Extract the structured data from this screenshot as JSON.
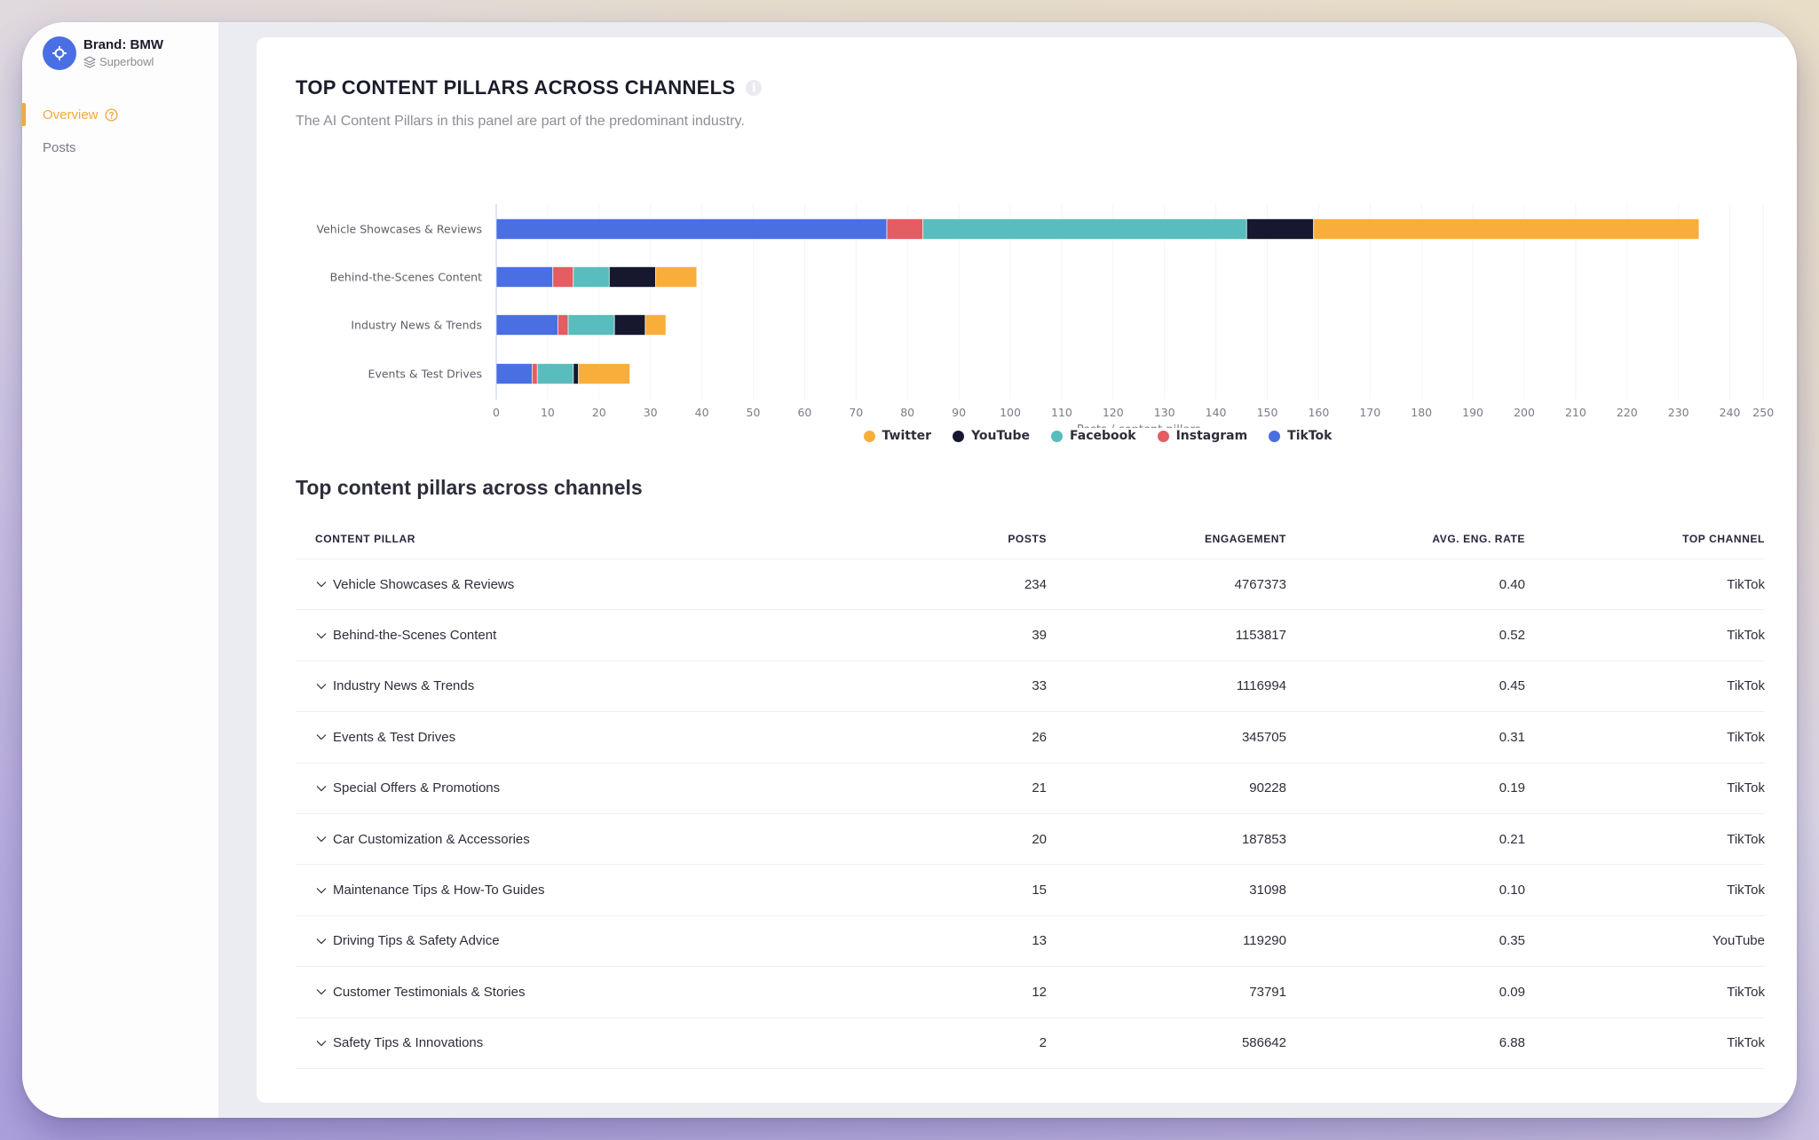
{
  "sidebar": {
    "brand_name": "Brand: BMW",
    "brand_sub": "Superbowl",
    "nav": [
      {
        "label": "Overview",
        "active": true
      },
      {
        "label": "Posts",
        "active": false
      }
    ]
  },
  "panel": {
    "title": "TOP CONTENT PILLARS ACROSS CHANNELS",
    "subtitle": "The AI Content Pillars in this panel are part of the predominant industry."
  },
  "colors": {
    "Twitter": "#f9ae3b",
    "YouTube": "#161830",
    "Facebook": "#58bdbc",
    "Instagram": "#e35d62",
    "TikTok": "#4a6fe3",
    "accent": "#f4a93c"
  },
  "chart_data": {
    "type": "bar",
    "orientation": "horizontal",
    "stacked": true,
    "title": "",
    "xlabel": "Posts / content pillars",
    "ylabel": "",
    "xlim": [
      0,
      250
    ],
    "xticks": [
      0,
      10,
      20,
      30,
      40,
      50,
      60,
      70,
      80,
      90,
      100,
      110,
      120,
      130,
      140,
      150,
      160,
      170,
      180,
      190,
      200,
      210,
      220,
      230,
      240,
      250
    ],
    "grid": true,
    "legend_position": "bottom",
    "categories": [
      "Vehicle Showcases & Reviews",
      "Behind-the-Scenes Content",
      "Industry News & Trends",
      "Events & Test Drives"
    ],
    "series": [
      {
        "name": "TikTok",
        "values": [
          76,
          11,
          12,
          7
        ]
      },
      {
        "name": "Instagram",
        "values": [
          7,
          4,
          2,
          1
        ]
      },
      {
        "name": "Facebook",
        "values": [
          63,
          7,
          9,
          7
        ]
      },
      {
        "name": "YouTube",
        "values": [
          13,
          9,
          6,
          1
        ]
      },
      {
        "name": "Twitter",
        "values": [
          75,
          8,
          4,
          10
        ]
      }
    ],
    "legend_order": [
      "Twitter",
      "YouTube",
      "Facebook",
      "Instagram",
      "TikTok"
    ]
  },
  "table": {
    "title": "Top content pillars across channels",
    "headers": [
      "CONTENT PILLAR",
      "POSTS",
      "ENGAGEMENT",
      "AVG. ENG. RATE",
      "TOP CHANNEL"
    ],
    "rows": [
      {
        "pillar": "Vehicle Showcases & Reviews",
        "posts": "234",
        "engagement": "4767373",
        "rate": "0.40",
        "channel": "TikTok"
      },
      {
        "pillar": "Behind-the-Scenes Content",
        "posts": "39",
        "engagement": "1153817",
        "rate": "0.52",
        "channel": "TikTok"
      },
      {
        "pillar": "Industry News & Trends",
        "posts": "33",
        "engagement": "1116994",
        "rate": "0.45",
        "channel": "TikTok"
      },
      {
        "pillar": "Events & Test Drives",
        "posts": "26",
        "engagement": "345705",
        "rate": "0.31",
        "channel": "TikTok"
      },
      {
        "pillar": "Special Offers & Promotions",
        "posts": "21",
        "engagement": "90228",
        "rate": "0.19",
        "channel": "TikTok"
      },
      {
        "pillar": "Car Customization & Accessories",
        "posts": "20",
        "engagement": "187853",
        "rate": "0.21",
        "channel": "TikTok"
      },
      {
        "pillar": "Maintenance Tips & How-To Guides",
        "posts": "15",
        "engagement": "31098",
        "rate": "0.10",
        "channel": "TikTok"
      },
      {
        "pillar": "Driving Tips & Safety Advice",
        "posts": "13",
        "engagement": "119290",
        "rate": "0.35",
        "channel": "YouTube"
      },
      {
        "pillar": "Customer Testimonials & Stories",
        "posts": "12",
        "engagement": "73791",
        "rate": "0.09",
        "channel": "TikTok"
      },
      {
        "pillar": "Safety Tips & Innovations",
        "posts": "2",
        "engagement": "586642",
        "rate": "6.88",
        "channel": "TikTok"
      }
    ]
  }
}
